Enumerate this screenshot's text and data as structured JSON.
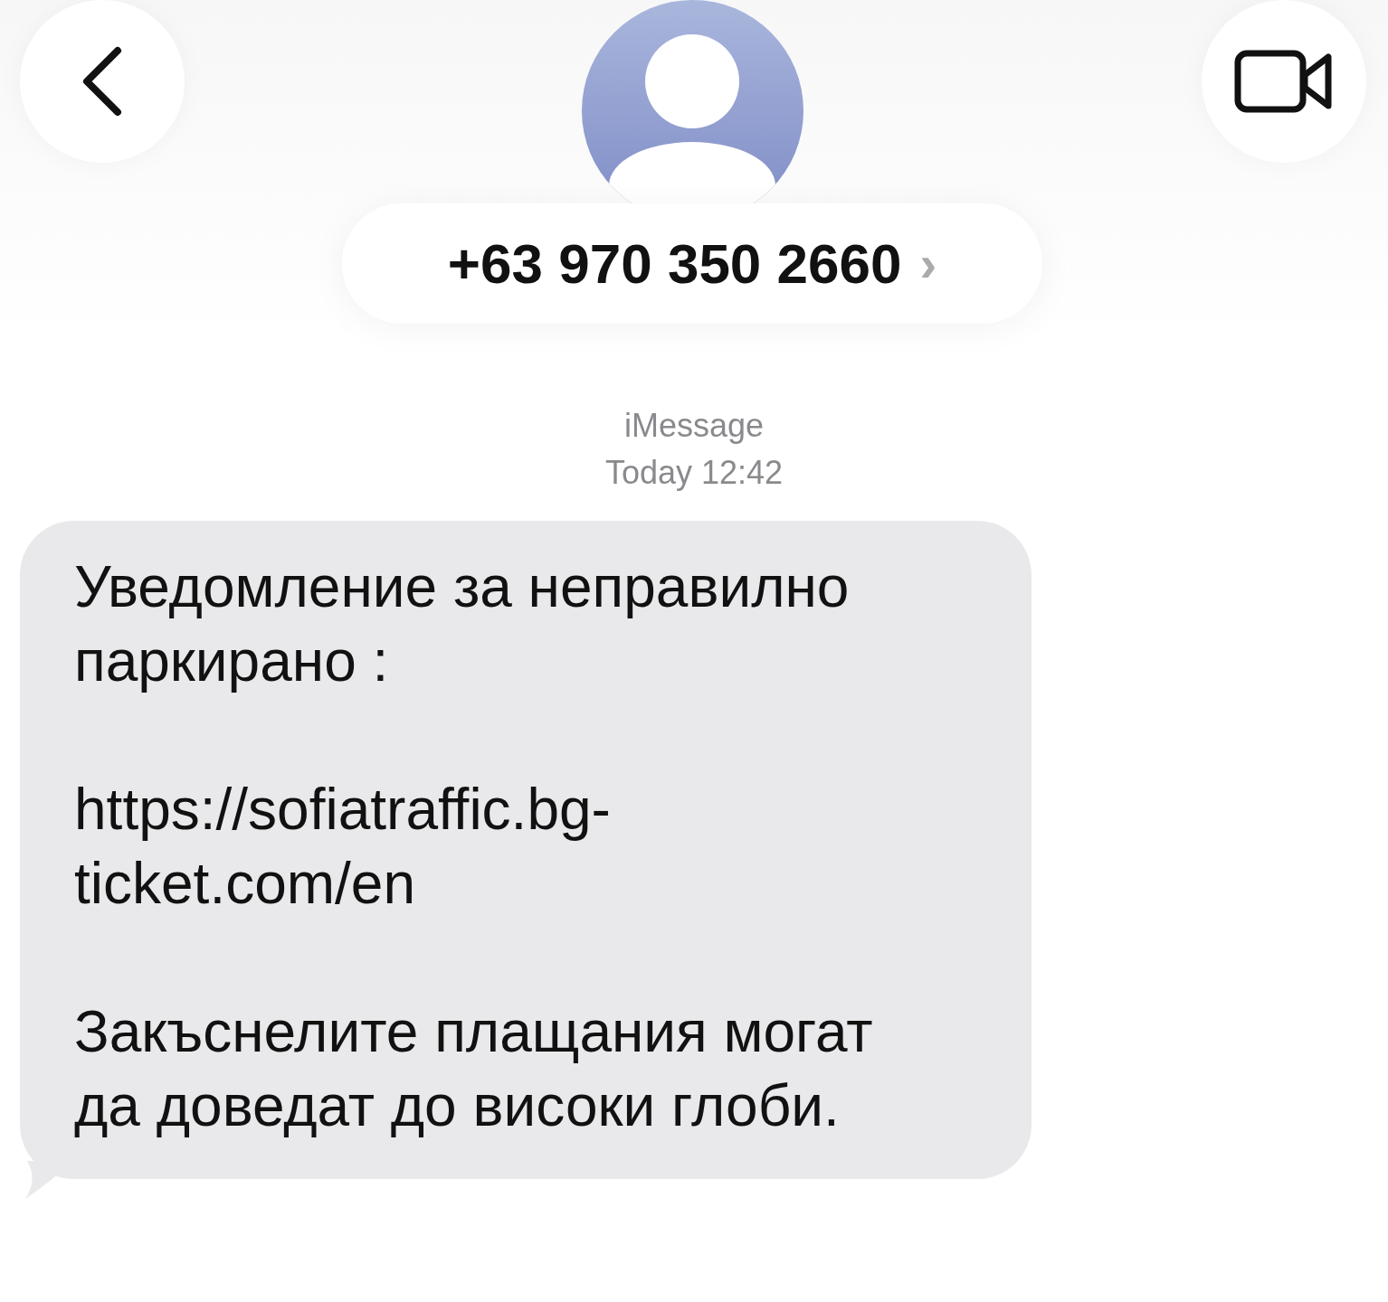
{
  "header": {
    "contact": "+63 970 350 2660",
    "chevron": "›"
  },
  "meta": {
    "service": "iMessage",
    "timestamp": "Today 12:42"
  },
  "messages": [
    {
      "paragraphs": [
        "Уведомление за неправилно паркирано :",
        "https://sofiatraffic.bg-ticket.com/en",
        "Закъснелите плащания могат да доведат до високи глоби."
      ]
    }
  ]
}
